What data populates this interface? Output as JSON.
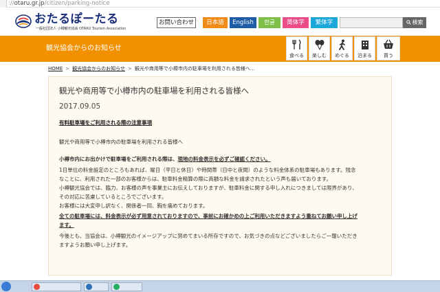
{
  "address_bar": {
    "url_host": "otaru.gr.jp",
    "url_path": "/citizen/parking-notice",
    "scheme_prefix": "://"
  },
  "header": {
    "logo_text": "おたるぽーたる",
    "logo_sub": "一般社団法人 小樽観光協会 OTARU Tourism Association",
    "contact_label": "お問い合わせ",
    "languages": [
      "日本語",
      "English",
      "한글",
      "简体字",
      "繁体字"
    ],
    "search_button": "検索",
    "search_placeholder": ""
  },
  "orange_bar": {
    "section_title": "観光協会からのお知らせ",
    "nav": [
      "食べる",
      "楽しむ",
      "めぐる",
      "泊まる",
      "買う"
    ]
  },
  "breadcrumb": {
    "home": "HOME",
    "parent": "観光協会からのお知らせ",
    "current": "観光や商用等で小樽市内の駐車場を利用される皆様へ…",
    "separator": ">"
  },
  "article": {
    "title": "観光や商用等で小樽市内の駐車場を利用される皆様へ",
    "date": "2017.09.05",
    "subhead": "有料駐車場をご利用される際の注意事項",
    "intro": "観光や商用等で小樽市内の駐車場を利用される皆様へ",
    "p1_lead": "小樽市内にお出かけで駐車場をご利用される際は、",
    "p1_emph": "現地の料金表示を必ずご確認ください。",
    "lines": [
      "1日単位の料金設定のところもあれば、曜日（平日と休日）や時間帯（日中と夜間）のような料金体系の駐車場もあります。残念",
      "なことに、利用された一部のお客様からは、駐車料金精算の際に高額な料金を請求されたという声も届いております。",
      "小樽観光協会では、臨力、お客様の声を事業主にお伝えしておりますが、駐車料金に関する申し入れにつきましては限界があり、",
      "その対応に苦慮しているところでございます。",
      "お客様には大変申し訳なく、関係者一同、胸を痛めております。"
    ],
    "emph_lines": [
      "全ての駐車場には、料金表示が必ず用意されておりますので、事前にお確かめの上ご利用いただきますよう重ねてお願い申し上げ",
      "ます。"
    ],
    "closing": [
      "今後とも、当協会は、小樽観光のイメージアップに努めてまいる所存ですので、お気づきの点などございましたらご一報いただき",
      "ますようお願い申し上げます。"
    ]
  },
  "colors": {
    "orange": "#f29100",
    "navy": "#1b2f7a",
    "ja": "#f08a19",
    "en": "#1f5ca8",
    "ko": "#7ec047",
    "zhs": "#e94c86",
    "zht": "#1ba7d9"
  },
  "icons": [
    "globe-icon",
    "fork-knife-icon",
    "balloons-icon",
    "walker-icon",
    "building-icon",
    "basket-icon",
    "search-icon"
  ]
}
